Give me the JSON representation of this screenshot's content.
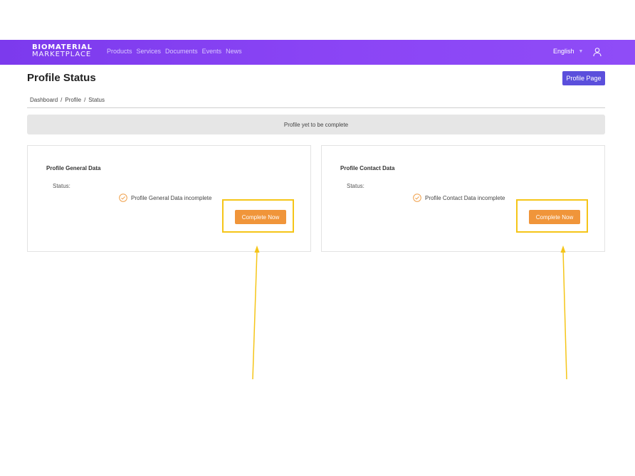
{
  "brand": {
    "line1": "BIOMATERIAL",
    "line2": "MARKETPLACE"
  },
  "nav": {
    "links": [
      "Products",
      "Services",
      "Documents",
      "Events",
      "News"
    ],
    "language": "English",
    "user_icon": "user-icon"
  },
  "header": {
    "title": "Profile Status",
    "profile_page_label": "Profile Page"
  },
  "breadcrumb": {
    "items": [
      "Dashboard",
      "Profile",
      "Status"
    ],
    "separator": "/"
  },
  "alert": {
    "text": "Profile yet to be complete"
  },
  "cards": [
    {
      "title": "Profile General Data",
      "status_label": "Status:",
      "status_text": "Profile General Data incomplete",
      "action_label": "Complete Now"
    },
    {
      "title": "Profile Contact Data",
      "status_label": "Status:",
      "status_text": "Profile Contact Data incomplete",
      "action_label": "Complete Now"
    }
  ],
  "colors": {
    "nav_bg": "#8b45f5",
    "primary_button": "#5b4fdc",
    "action_button": "#f0953a",
    "highlight": "#f5c518",
    "status_icon": "#f0a04b"
  }
}
